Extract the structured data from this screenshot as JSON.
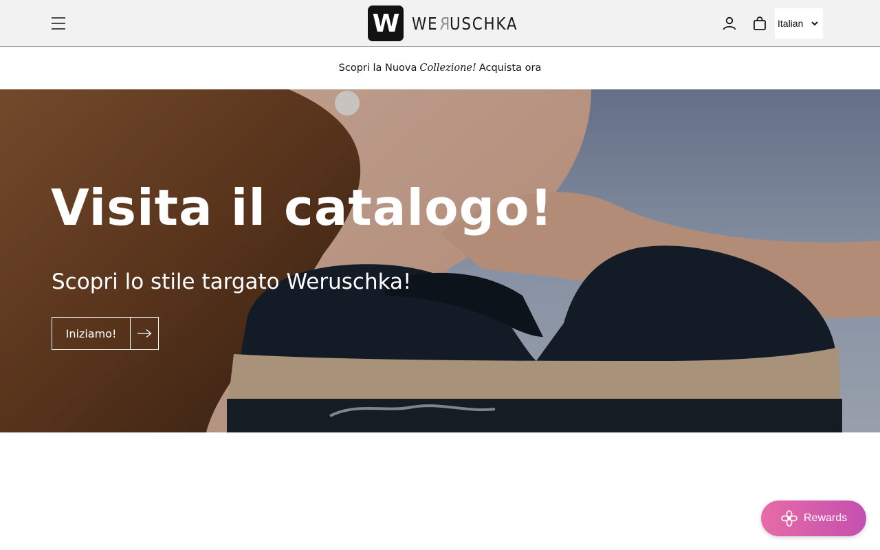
{
  "header": {
    "logo_mark": "W",
    "logo_word_part1": "WE",
    "logo_word_mirror": "R",
    "logo_word_part2": "USCHKA",
    "language": {
      "selected": "Italian"
    }
  },
  "announcement": {
    "prefix": "Scopri la Nuova",
    "italic": "Collezione!",
    "suffix": "Acquista ora"
  },
  "hero": {
    "title": "Visita il catalogo!",
    "subtitle": "Scopri lo stile targato Weruschka!",
    "button_label": "Iniziamo!"
  },
  "rewards": {
    "label": "Rewards",
    "colors": {
      "start": "#e76ba6",
      "end": "#c44fb0"
    }
  },
  "icons": {
    "menu": "hamburger-menu-icon",
    "account": "account-icon",
    "cart": "shopping-bag-icon",
    "select": "chevron-down-icon",
    "button": "arrow-right-icon",
    "rewards": "flower-icon"
  }
}
